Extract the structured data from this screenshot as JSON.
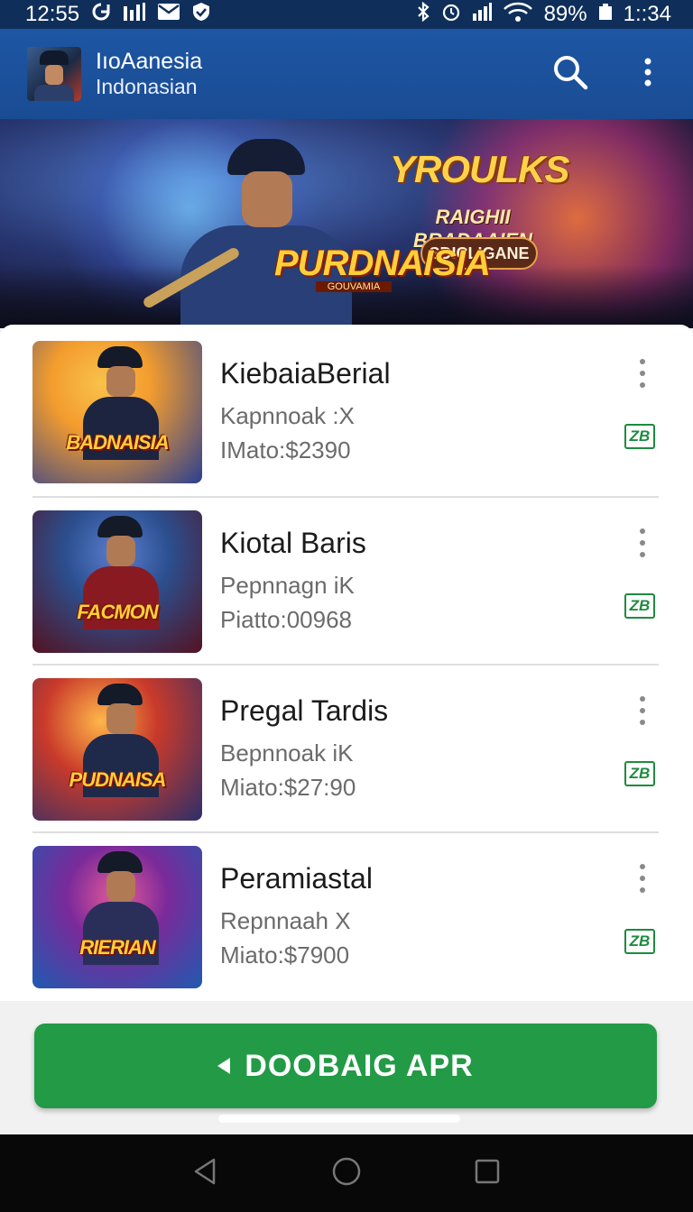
{
  "status_bar": {
    "time": "12:55",
    "battery": "89%",
    "clock_right": "1::34",
    "left_icons": [
      "sync-icon",
      "signal-bars-icon",
      "mail-icon",
      "shield-check-icon"
    ],
    "right_icons": [
      "bluetooth-icon",
      "alarm-icon",
      "cell-signal-icon",
      "wifi-icon",
      "battery-icon"
    ]
  },
  "app_bar": {
    "title": "IıoAanesia",
    "subtitle": "Indonasian",
    "actions": [
      "search-icon",
      "overflow-menu-icon"
    ]
  },
  "banner": {
    "title": "YROULKS",
    "subtitle": "RAIGHII BRADAAIEN",
    "button": "SDICLIGANE",
    "logo": "PURDNAISIA",
    "logo_sub": "GOUVAMIA",
    "colors": {
      "accent": "#ffd24d",
      "warm_glow": "#ff783c",
      "cool_glow": "#4f7ac7"
    }
  },
  "list": {
    "items": [
      {
        "title": "KiebaiaBerial",
        "subtitle": "Kapnnoak :X",
        "price": "IMato:$2390",
        "badge": "ZB",
        "thumb_logo": "BADNAISIA",
        "thumb_colors": [
          "#f39c2e",
          "#2a3f8f"
        ]
      },
      {
        "title": "Kiotal Baris",
        "subtitle": "Pepnnagn iK",
        "price": "Piatto:00968",
        "badge": "ZB",
        "thumb_logo": "FACMON",
        "thumb_colors": [
          "#2b4f8f",
          "#b8222a"
        ]
      },
      {
        "title": "Pregal Tardis",
        "subtitle": "Bepnnoak iK",
        "price": "Miato:$27:90",
        "badge": "ZB",
        "thumb_logo": "PUDNAISA",
        "thumb_colors": [
          "#c93a2a",
          "#2b2f6a"
        ]
      },
      {
        "title": "Peramiastal",
        "subtitle": "Repnnaah X",
        "price": "Miato:$7900",
        "badge": "ZB",
        "thumb_logo": "RIERIAN",
        "thumb_colors": [
          "#7a2a9a",
          "#1f5ab0"
        ]
      }
    ]
  },
  "cta": {
    "label": "DOOBAIG APR",
    "color": "#229a46"
  },
  "nav_bar": {
    "buttons": [
      "back-icon",
      "home-icon",
      "recents-icon"
    ]
  }
}
